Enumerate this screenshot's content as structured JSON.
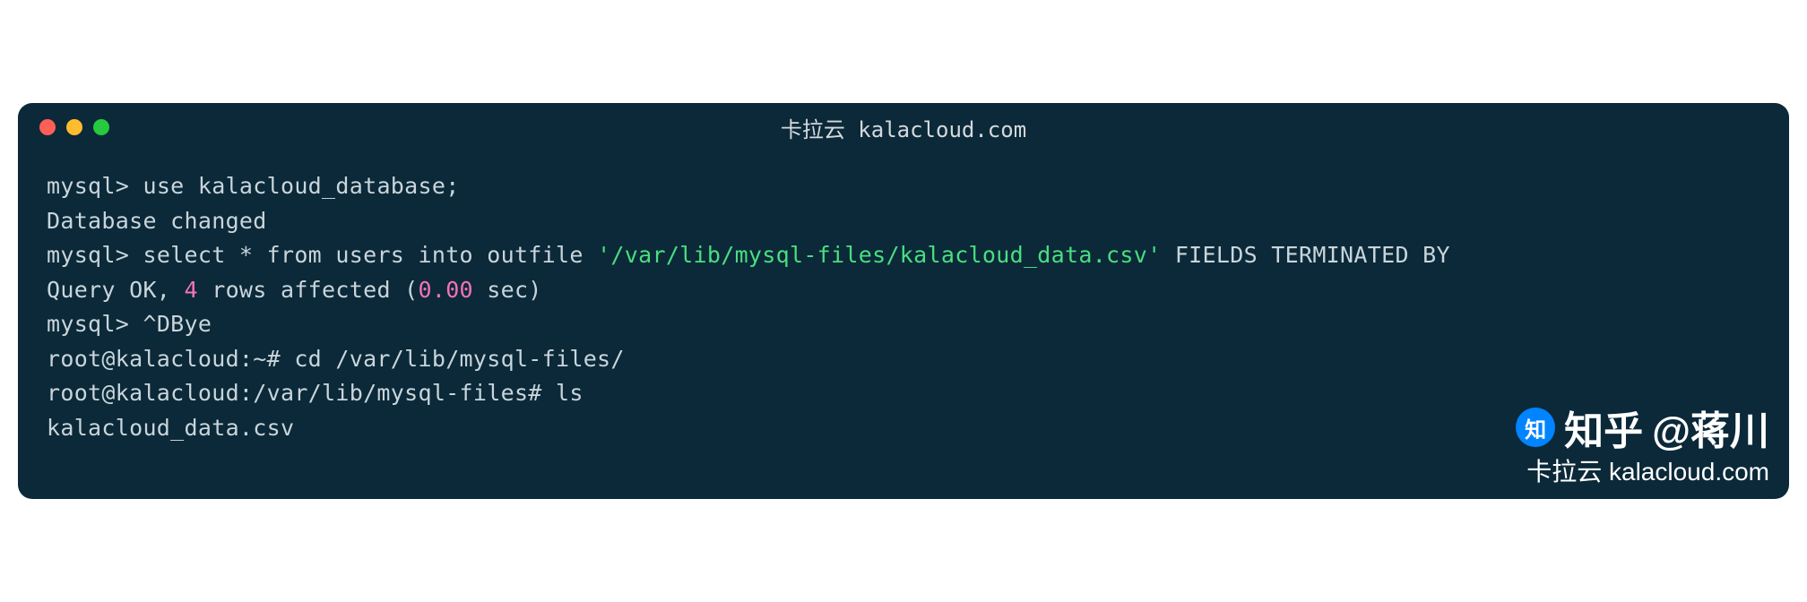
{
  "window": {
    "title": "卡拉云 kalacloud.com"
  },
  "terminal": {
    "line1_prompt": "mysql> ",
    "line1_cmd": "use kalacloud_database;",
    "line2": "Database changed",
    "line3_empty": "",
    "line4_prompt": "mysql> ",
    "line4_cmd_a": "select * from users into outfile ",
    "line4_string": "'/var/lib/mysql-files/kalacloud_data.csv'",
    "line4_cmd_b": " FIELDS TERMINATED BY ",
    "line5_a": "Query OK, ",
    "line5_num1": "4",
    "line5_b": " rows affected (",
    "line5_num2": "0.00",
    "line5_c": " sec)",
    "line6_empty": "",
    "line7_prompt": "mysql> ",
    "line7_cmd": "^DBye",
    "line8_prompt": "root@kalacloud:~# ",
    "line8_cmd": "cd /var/lib/mysql-files/",
    "line9_prompt": "root@kalacloud:/var/lib/mysql-files# ",
    "line9_cmd": "ls",
    "line10": "kalacloud_data.csv"
  },
  "watermark": {
    "zhihu": "知乎",
    "author": "@蒋川",
    "brand": "卡拉云 kalacloud.com"
  }
}
